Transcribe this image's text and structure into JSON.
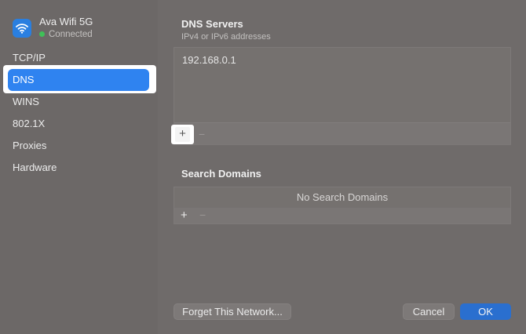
{
  "network": {
    "name": "Ava Wifi 5G",
    "status": "Connected",
    "icon": "wifi-icon",
    "status_color": "#3fc058"
  },
  "sidebar": {
    "items": [
      {
        "label": "TCP/IP",
        "active": false
      },
      {
        "label": "DNS",
        "active": true
      },
      {
        "label": "WINS",
        "active": false
      },
      {
        "label": "802.1X",
        "active": false
      },
      {
        "label": "Proxies",
        "active": false
      },
      {
        "label": "Hardware",
        "active": false
      }
    ]
  },
  "dns_servers": {
    "title": "DNS Servers",
    "subtitle": "IPv4 or IPv6 addresses",
    "entries": [
      "192.168.0.1"
    ],
    "add_label": "+",
    "remove_label": "−"
  },
  "search_domains": {
    "title": "Search Domains",
    "empty_text": "No Search Domains",
    "add_label": "+",
    "remove_label": "−"
  },
  "footer": {
    "forget_label": "Forget This Network...",
    "cancel_label": "Cancel",
    "ok_label": "OK"
  },
  "colors": {
    "accent": "#2f83f0",
    "ok_button": "#2a6fcf"
  }
}
